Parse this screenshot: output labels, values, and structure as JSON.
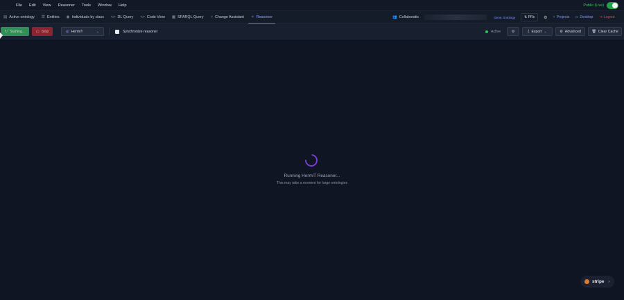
{
  "menu": {
    "items": [
      "File",
      "Edit",
      "View",
      "Reasoner",
      "Tools",
      "Window",
      "Help"
    ],
    "public_label": "Public (Live)"
  },
  "tabs": [
    {
      "label": "Active ontology",
      "icon": "document-icon"
    },
    {
      "label": "Entities",
      "icon": "list-icon"
    },
    {
      "label": "Individuals by class",
      "icon": "eye-icon"
    },
    {
      "label": "DL Query",
      "icon": "code-icon"
    },
    {
      "label": "Code View",
      "icon": "code-icon"
    },
    {
      "label": "SPARQL Query",
      "icon": "table-icon"
    },
    {
      "label": "Change Assistant",
      "icon": "branch-icon"
    },
    {
      "label": "Reasoner",
      "icon": "sparkle-icon"
    }
  ],
  "header_right": {
    "collab_label": "Collaboratic",
    "gene_label": "Gene Ontology",
    "prs_label": "PRs",
    "projects_label": "Projects",
    "desktop_label": "Desktop",
    "logout_label": "Logout"
  },
  "toolbar": {
    "start_label": "Starting...",
    "stop_label": "Stop",
    "reasoner_select": "HermiT",
    "sync_label": "Synchronize reasoner",
    "status_label": "Active",
    "export_label": "Export",
    "advanced_label": "Advanced",
    "clear_cache_label": "Clear Cache"
  },
  "main": {
    "loading_title": "Running HermiT Reasoner...",
    "loading_sub": "This may take a moment for large ontologies"
  },
  "stripe_label": "stripe",
  "colors": {
    "background": "#0f1523",
    "accent": "#6e7cff",
    "start_green": "#2f8f55",
    "stop_red": "#8c2430",
    "spinner": "#7a3cd8",
    "live_toggle": "#22a34a",
    "logout_red": "#e04a4a"
  }
}
